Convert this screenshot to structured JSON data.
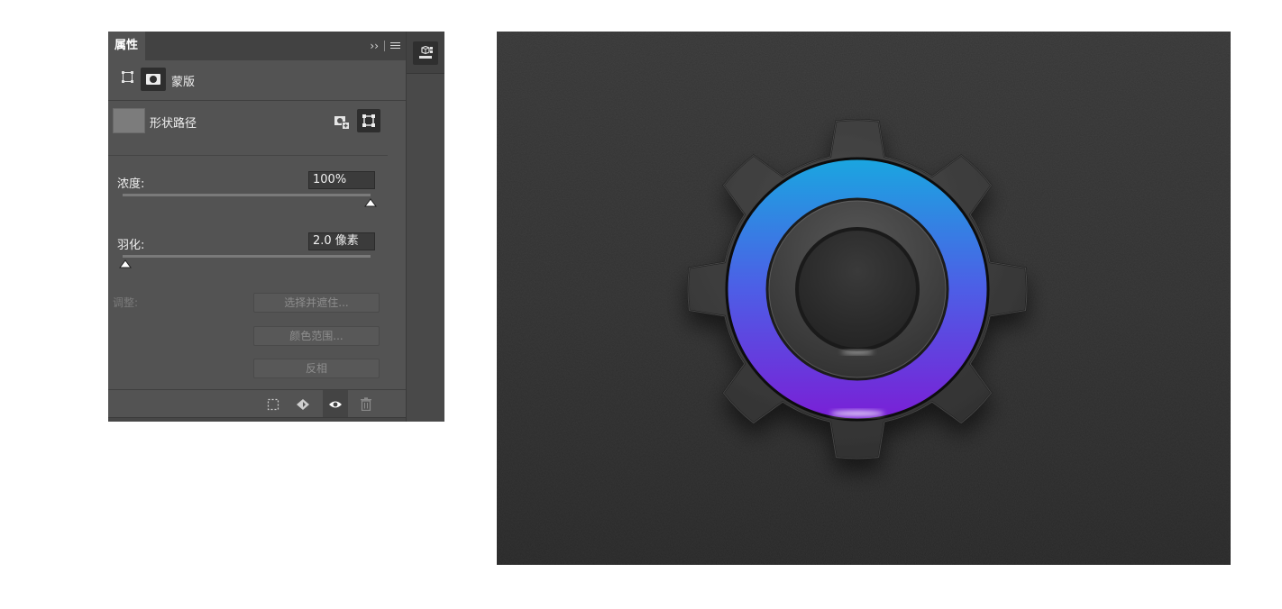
{
  "panel": {
    "tab_title": "属性",
    "collapse_glyph": "››",
    "mask_type_label": "蒙版",
    "layer_name": "形状路径",
    "density": {
      "label": "浓度:",
      "value": "100%",
      "slider_fraction": 1.0
    },
    "feather": {
      "label": "羽化:",
      "value": "2.0 像素",
      "slider_fraction": 0.01
    },
    "adjust": {
      "label": "调整:",
      "buttons": [
        "选择并遮住...",
        "颜色范围...",
        "反相"
      ]
    },
    "icons": {
      "pixel_mask": "pixel-mask-icon",
      "vector_mask": "vector-mask-icon",
      "add_mask": "add-mask-icon",
      "select_mask": "select-vector-mask-icon",
      "load_selection": "load-selection-icon",
      "apply_mask": "apply-mask-icon",
      "visibility": "eye-icon",
      "delete": "trash-icon",
      "dock": "3d-panel-icon"
    }
  },
  "artwork": {
    "subject": "gear-settings-icon",
    "colors": {
      "ring_top": "#1aa6e0",
      "ring_mid": "#4d5ee6",
      "ring_bottom": "#7a1fd6",
      "background": "#2e2e2e"
    }
  }
}
